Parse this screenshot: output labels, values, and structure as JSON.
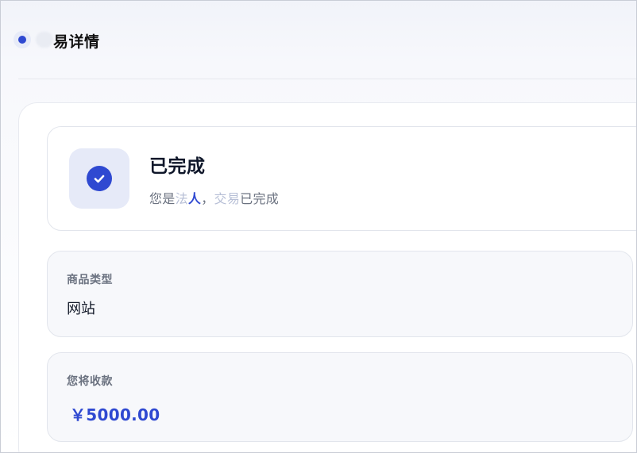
{
  "header": {
    "title": "易详情"
  },
  "status": {
    "title": "已完成",
    "description_prefix": "您是",
    "description_mask_a": "法",
    "description_mask_b": "人",
    "description_sep": "，",
    "description_mask_c": "交",
    "description_mask_d": "易",
    "description_suffix": "已完成",
    "icon": "check-circle-icon",
    "accent_color": "#2f49d1"
  },
  "details": {
    "product_type": {
      "label": "商品类型",
      "value": "网站"
    },
    "receive_amount": {
      "label": "您将收款",
      "value": "￥5000.00"
    }
  }
}
